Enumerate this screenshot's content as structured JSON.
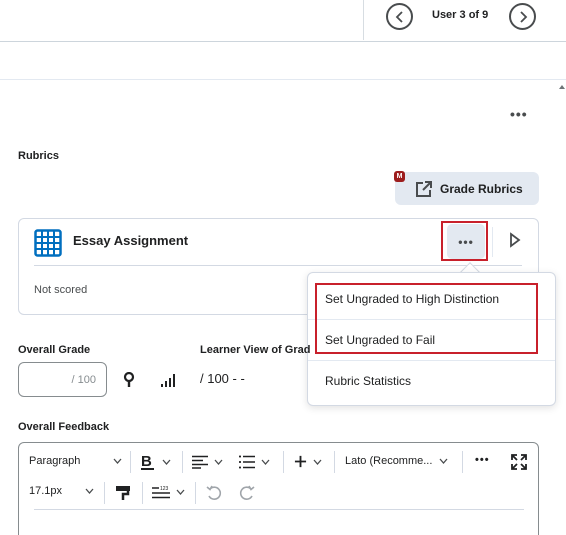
{
  "topbar": {
    "user_position": "User 3 of 9",
    "prev_icon": "chevron-left-icon",
    "next_icon": "chevron-right-icon"
  },
  "page_more_icon": "more-horizontal-icon",
  "rubrics": {
    "section_label": "Rubrics",
    "grade_rubrics_button": "Grade Rubrics",
    "badge": "M",
    "card": {
      "title": "Essay Assignment",
      "status": "Not scored",
      "more_label": "•••"
    },
    "menu": {
      "items": [
        {
          "label": "Set Ungraded to High Distinction"
        },
        {
          "label": "Set Ungraded to Fail"
        },
        {
          "label": "Rubric Statistics"
        }
      ]
    }
  },
  "grade": {
    "overall_label": "Overall Grade",
    "input_value": "",
    "input_suffix": "/ 100",
    "learner_view_label": "Learner View of Grade",
    "learner_view_value": "/ 100 - -"
  },
  "feedback": {
    "label": "Overall Feedback",
    "toolbar": {
      "format_select": "Paragraph",
      "font_select": "Lato (Recomme...",
      "font_size_select": "17.1px",
      "more_label": "•••"
    }
  },
  "colors": {
    "highlight": "#c8202b",
    "button_bg": "#e3e9f1",
    "rubric_icon": "#006fbf",
    "badge": "#9d1d1d"
  }
}
